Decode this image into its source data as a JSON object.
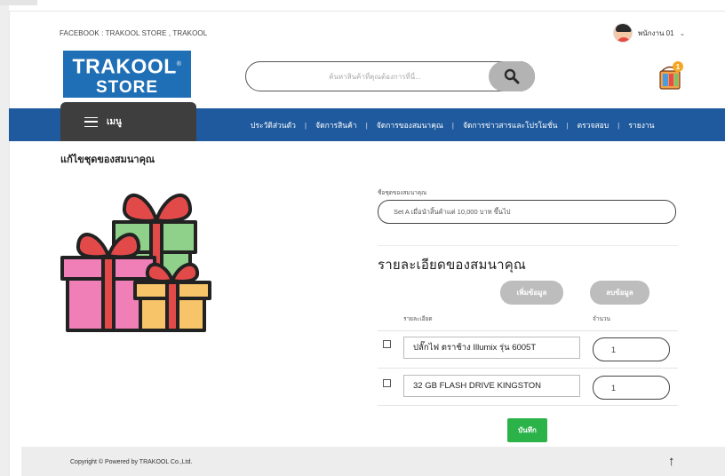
{
  "header": {
    "facebook_text": "FACEBOOK : TRAKOOL STORE , TRAKOOL",
    "user_name": "พนักงาน 01",
    "chevron": "⌄",
    "logo_line1": "TRAKOOL",
    "logo_reg": "®",
    "logo_line2": "STORE",
    "search_placeholder": "ค้นหาสินค้าที่คุณต้องการที่นี่...",
    "cart_badge": "1"
  },
  "nav": {
    "menu_label": "เมนู",
    "items": [
      "ประวัติส่วนตัว",
      "จัดการสินค้า",
      "จัดการของสมนาคุณ",
      "จัดการข่าวสารและโปรโมชั่น",
      "ตรวจสอบ",
      "รายงาน"
    ],
    "separator": "|"
  },
  "page": {
    "title": "แก้ไขชุดของสมนาคุณ",
    "set_name_label": "ชื่อชุดของสมนาคุณ",
    "set_name_value": "Set A เมื่อนำสิ้นค้าแต่ 10,000 บาท ขึ้นไป",
    "section_title": "รายละเอียดของสมนาคุณ",
    "add_button": "เพิ่มข้อมูล",
    "delete_button": "ลบข้อมูล",
    "col_detail": "รายละเอียด",
    "col_qty": "จำนวน",
    "rows": [
      {
        "detail": "ปลั๊กไฟ ตราช้าง Illumix รุ่น 6005T",
        "qty": "1"
      },
      {
        "detail": "32 GB FLASH DRIVE KINGSTON",
        "qty": "1"
      }
    ],
    "save_button": "บันทึก"
  },
  "footer": {
    "copyright": "Copyright © Powered by TRAKOOL Co.,Ltd.",
    "up_arrow": "↑"
  },
  "colors": {
    "nav_blue": "#1f5a9e",
    "logo_blue": "#1f6fb6",
    "menu_dark": "#3e3e3e",
    "save_green": "#2bb34a",
    "button_grey": "#bdbdbd"
  }
}
